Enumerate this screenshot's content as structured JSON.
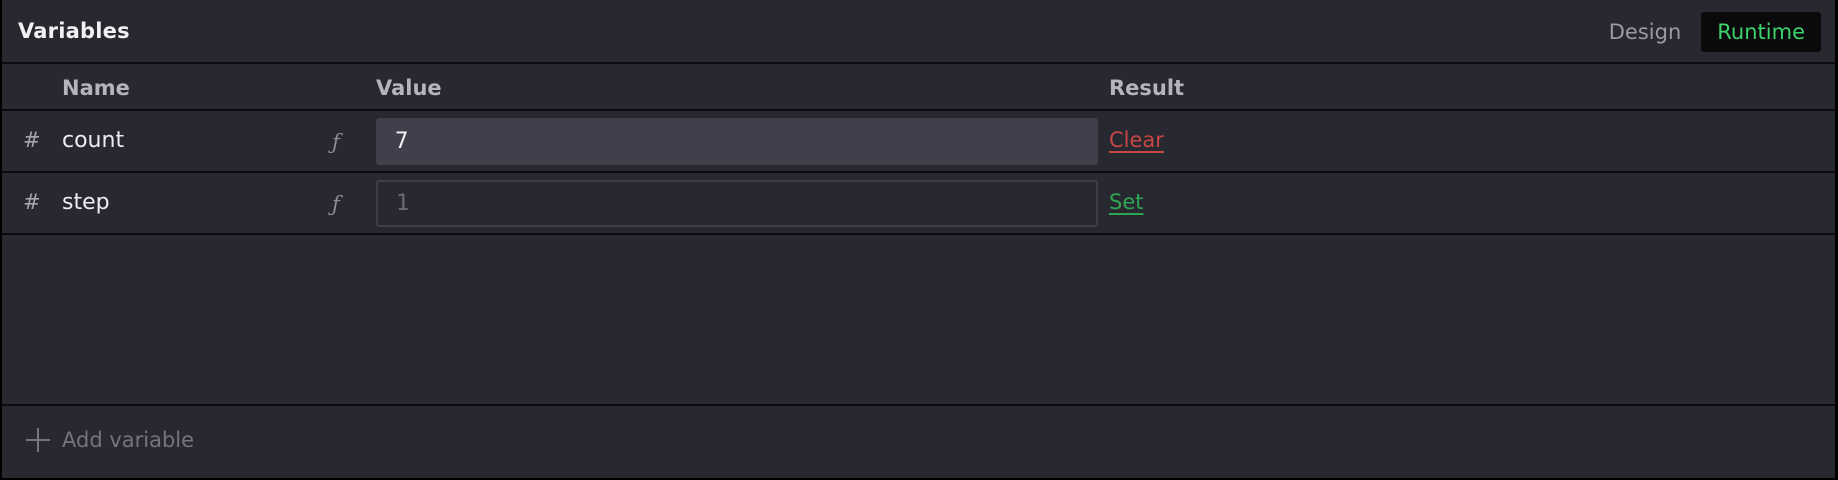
{
  "header": {
    "title": "Variables",
    "modes": {
      "design": "Design",
      "runtime": "Runtime",
      "active": "Runtime"
    }
  },
  "columns": {
    "name": "Name",
    "value": "Value",
    "result": "Result"
  },
  "variables": [
    {
      "type_glyph": "#",
      "name": "count",
      "fx_glyph": "ƒ",
      "value": "7",
      "placeholder": "",
      "action": "Clear"
    },
    {
      "type_glyph": "#",
      "name": "step",
      "fx_glyph": "ƒ",
      "value": "",
      "placeholder": "1",
      "action": "Set"
    }
  ],
  "footer": {
    "add_label": "Add variable"
  },
  "colors": {
    "panel_bg": "#282830",
    "runtime_accent": "#3dd36b",
    "clear_action": "#c74646",
    "set_action": "#2fa552"
  }
}
